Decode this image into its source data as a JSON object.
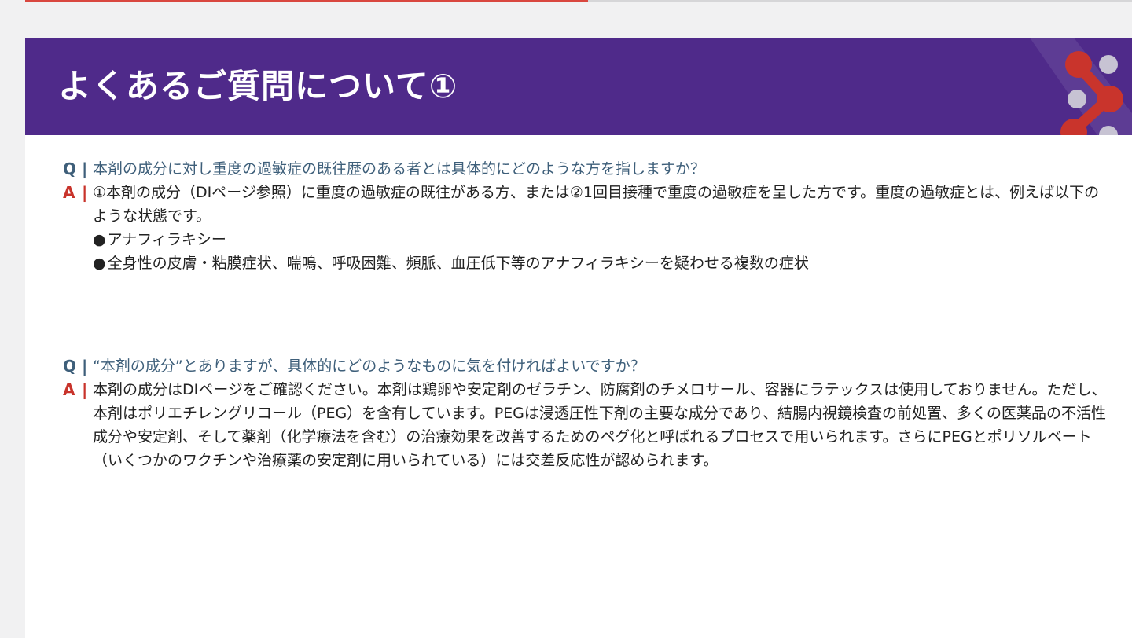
{
  "header": {
    "title": "よくあるご質問について①"
  },
  "qa": [
    {
      "q_marker": "Q",
      "a_marker": "A",
      "bar": "|",
      "question": "本剤の成分に対し重度の過敏症の既往歴のある者とは具体的にどのような方を指しますか？",
      "answer": "①本剤の成分（DIページ参照）に重度の過敏症の既往がある方、または②1回目接種で重度の過敏症を呈した方です。重度の過敏症とは、例えば以下のような状態です。",
      "bullets": [
        "アナフィラキシー",
        "全身性の皮膚・粘膜症状、喘鳴、呼吸困難、頻脈、血圧低下等のアナフィラキシーを疑わせる複数の症状"
      ]
    },
    {
      "q_marker": "Q",
      "a_marker": "A",
      "bar": "|",
      "question": "“本剤の成分”とありますが、具体的にどのようなものに気を付ければよいですか？",
      "answer": "本剤の成分はDIページをご確認ください。本剤は鶏卵や安定剤のゼラチン、防腐剤のチメロサール、容器にラテックスは使用しておりません。ただし、本剤はポリエチレングリコール（PEG）を含有しています。PEGは浸透圧性下剤の主要な成分であり、結腸内視鏡検査の前処置、多くの医薬品の不活性成分や安定剤、そして薬剤（化学療法を含む）の治療効果を改善するためのペグ化と呼ばれるプロセスで用いられます。さらにPEGとポリソルベート（いくつかのワクチンや治療薬の安定剤に用いられている）には交差反応性が認められます。"
    }
  ],
  "bullet_symbol": "●",
  "colors": {
    "header_bg": "#4f2a8a",
    "question": "#3e5f7a",
    "answer_marker": "#c8332b",
    "logo_red": "#c9342c",
    "logo_gray": "#c7c3d3"
  },
  "icons": {
    "logo": "molecule-logo-icon"
  }
}
